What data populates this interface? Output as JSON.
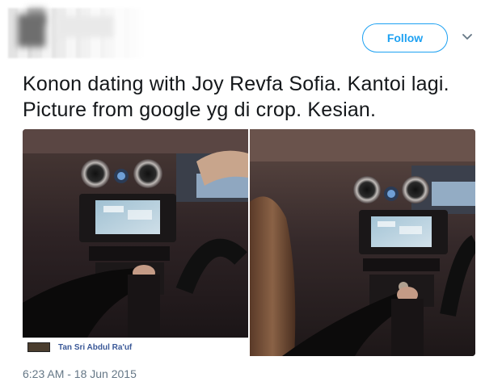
{
  "header": {
    "follow_label": "Follow",
    "more_icon": "chevron-down-icon"
  },
  "tweet": {
    "text": "Konon dating with Joy Revfa Sofia. Kantoi lagi. Picture from google yg di crop. Kesian.",
    "timestamp": "6:23 AM - 18 Jun 2015"
  },
  "media": {
    "photo_credit": "Tan Sri Abdul Ra'uf"
  },
  "colors": {
    "accent": "#1da1f2",
    "text": "#14171a",
    "muted": "#657786"
  }
}
